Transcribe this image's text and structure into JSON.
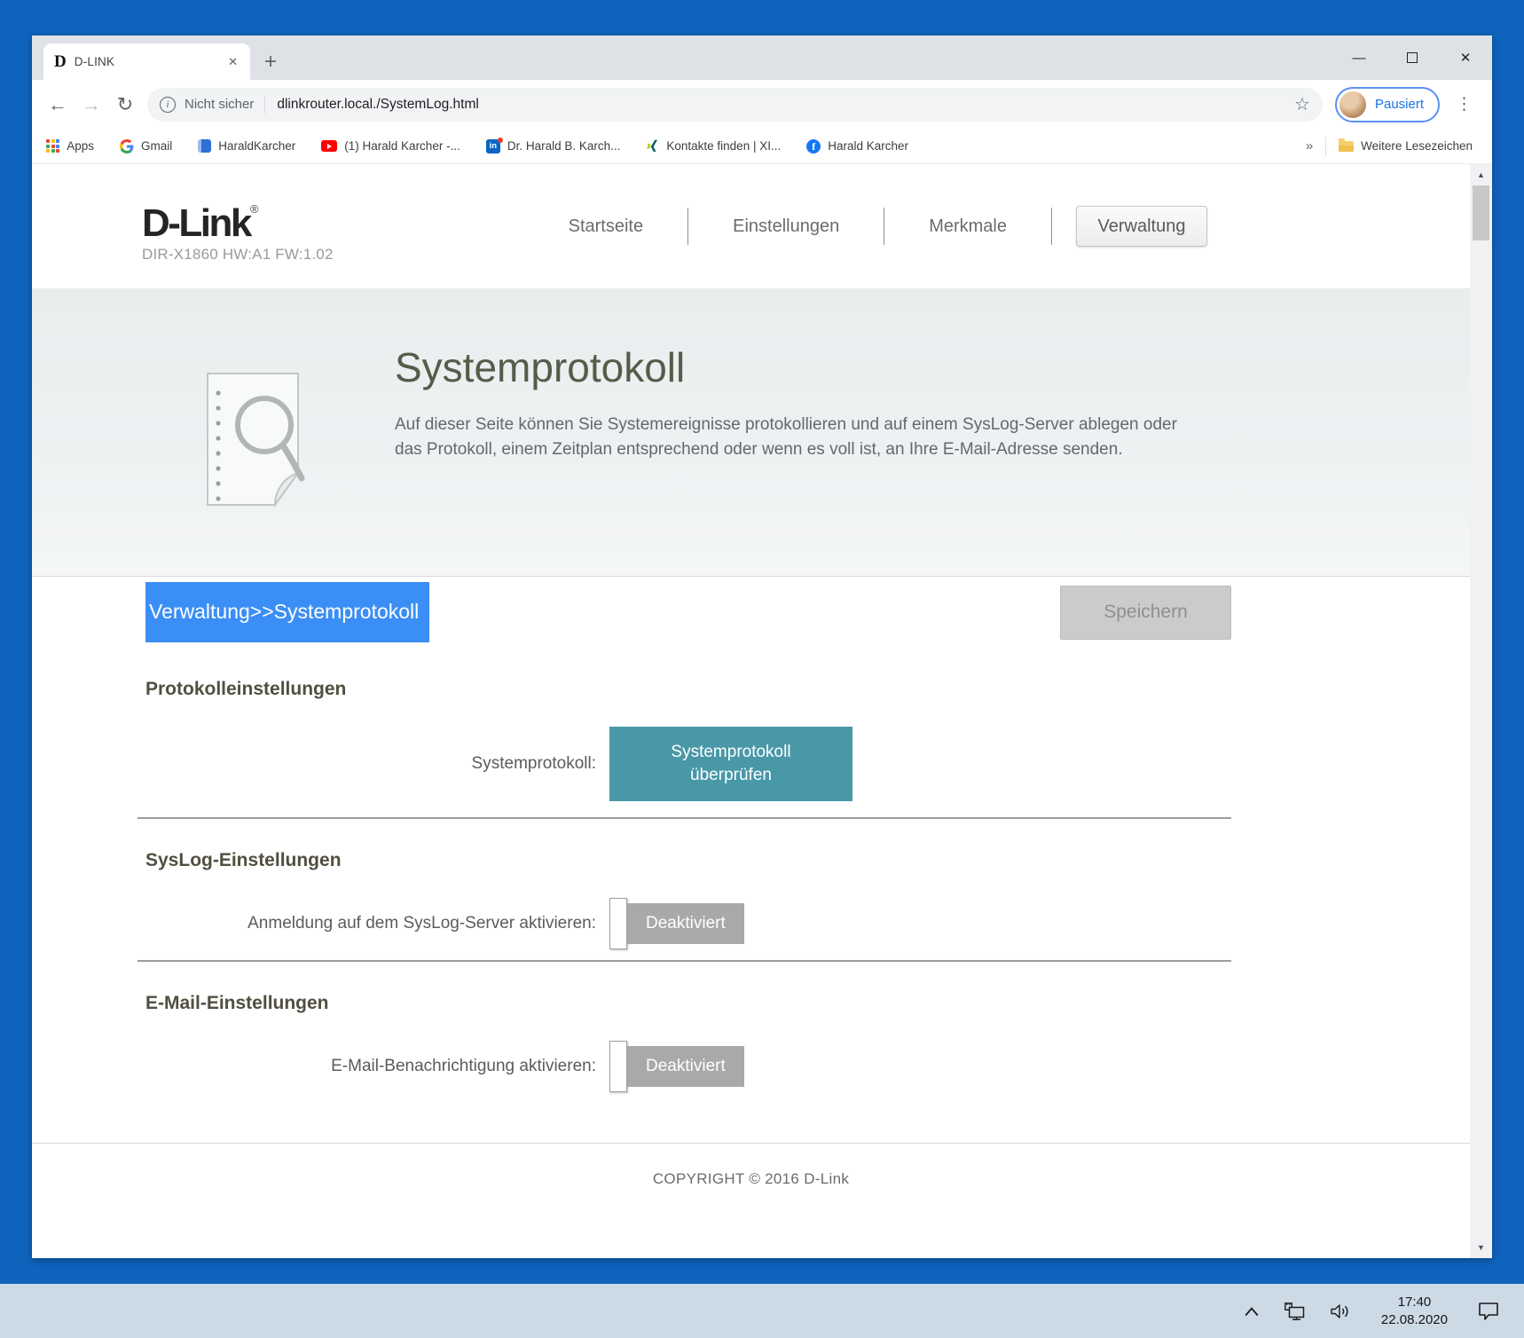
{
  "browser": {
    "tab": {
      "title": "D-LINK"
    },
    "address_bar": {
      "security_label": "Nicht sicher",
      "url": "dlinkrouter.local./SystemLog.html"
    },
    "profile": {
      "label": "Pausiert"
    },
    "bookmarks": [
      {
        "label": "Apps",
        "icon": "apps-grid-icon"
      },
      {
        "label": "Gmail",
        "icon": "google-g-icon"
      },
      {
        "label": "HaraldKarcher",
        "icon": "blue-site-icon"
      },
      {
        "label": "(1) Harald Karcher -...",
        "icon": "youtube-icon"
      },
      {
        "label": "Dr. Harald B. Karch...",
        "icon": "linkedin-icon"
      },
      {
        "label": "Kontakte finden | XI...",
        "icon": "xing-icon"
      },
      {
        "label": "Harald Karcher",
        "icon": "facebook-icon"
      }
    ],
    "bookmarks_overflow": "»",
    "more_bookmarks_label": "Weitere Lesezeichen"
  },
  "router_page": {
    "brand": {
      "name": "D-Link",
      "registered": "®",
      "model": "DIR-X1860 HW:A1 FW:1.02"
    },
    "nav": [
      {
        "label": "Startseite",
        "active": false
      },
      {
        "label": "Einstellungen",
        "active": false
      },
      {
        "label": "Merkmale",
        "active": false
      },
      {
        "label": "Verwaltung",
        "active": true
      }
    ],
    "hero": {
      "title": "Systemprotokoll",
      "description_line1": "Auf dieser Seite können Sie Systemereignisse protokollieren und auf einem SysLog-Server ablegen oder",
      "description_line2": "das Protokoll, einem Zeitplan entsprechend oder wenn es voll ist, an Ihre E-Mail-Adresse senden.",
      "icon": "log-document-magnifier-icon"
    },
    "breadcrumb": "Verwaltung>>Systemprotokoll",
    "save_button_label": "Speichern",
    "sections": [
      {
        "heading": "Protokolleinstellungen",
        "row": {
          "label": "Systemprotokoll:",
          "button_line1": "Systemprotokoll",
          "button_line2": "überprüfen"
        }
      },
      {
        "heading": "SysLog-Einstellungen",
        "row": {
          "label": "Anmeldung auf dem SysLog-Server aktivieren:",
          "toggle_value": "Deaktiviert",
          "toggle_state": "off"
        }
      },
      {
        "heading": "E-Mail-Einstellungen",
        "row": {
          "label": "E-Mail-Benachrichtigung aktivieren:",
          "toggle_value": "Deaktiviert",
          "toggle_state": "off"
        }
      }
    ],
    "footer": "COPYRIGHT © 2016 D-Link"
  },
  "taskbar": {
    "time": "17:40",
    "date": "22.08.2020",
    "tray_icons": [
      "chevron-up-icon",
      "network-icon",
      "volume-icon",
      "action-center-icon"
    ]
  },
  "icons": {
    "back_arrow": "←",
    "forward_arrow": "→",
    "reload": "↻",
    "info_letter": "i",
    "star": "☆",
    "menu_dots": "⋮",
    "minimize": "—",
    "close": "✕",
    "tab_close": "✕",
    "new_tab": "+",
    "scroll_up": "▲",
    "scroll_down": "▼",
    "favicon_letter": "D",
    "google_letter": "G",
    "linkedin_letters": "in",
    "facebook_letter": "f"
  },
  "colors": {
    "accent_teal": "#4898A8",
    "selection_blue": "#3B8EF6",
    "desktop_blue": "#0F63BD",
    "taskbar_bg": "#CCDAE6",
    "toggle_gray": "#A9A9A9",
    "save_button_gray": "#CBCBCB",
    "hero_title": "#575B49",
    "titlebar_gray": "#DEE1E6"
  }
}
